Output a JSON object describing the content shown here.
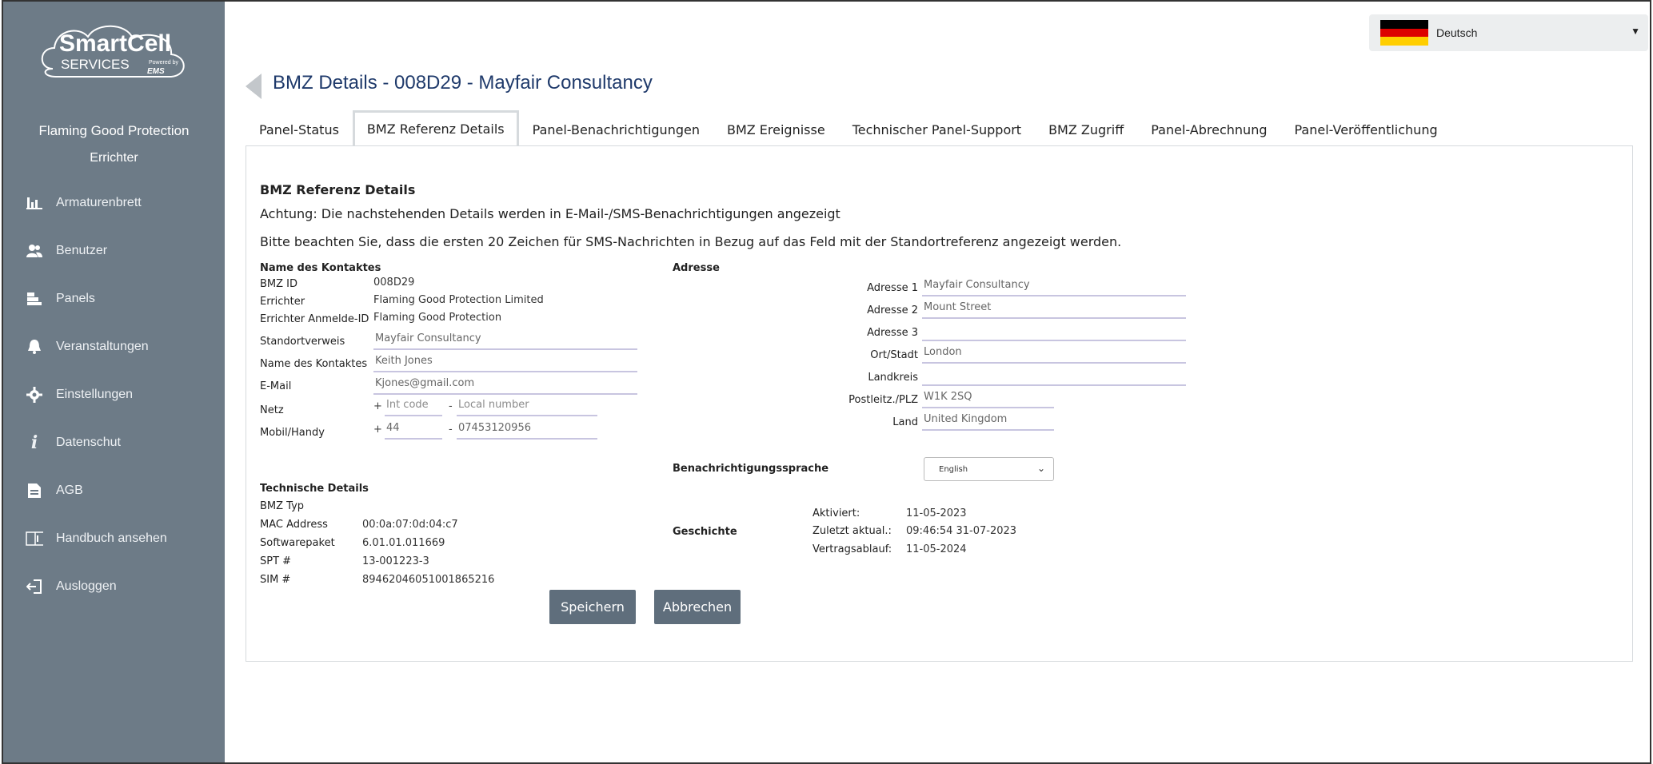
{
  "app": {
    "logo": {
      "line1": "SmartCell",
      "line2": "SERVICES",
      "powered": "Powered by",
      "brand": "EMS"
    },
    "company": "Flaming Good Protection",
    "role": "Errichter"
  },
  "sidebar": {
    "items": [
      {
        "label": "Armaturenbrett",
        "icon": "dashboard-icon"
      },
      {
        "label": "Benutzer",
        "icon": "users-icon"
      },
      {
        "label": "Panels",
        "icon": "panels-icon"
      },
      {
        "label": "Veranstaltungen",
        "icon": "bell-icon"
      },
      {
        "label": "Einstellungen",
        "icon": "gear-icon"
      },
      {
        "label": "Datenschut",
        "icon": "info-icon"
      },
      {
        "label": "AGB",
        "icon": "document-icon"
      },
      {
        "label": "Handbuch ansehen",
        "icon": "book-icon"
      },
      {
        "label": "Ausloggen",
        "icon": "logout-icon"
      }
    ]
  },
  "header": {
    "language": "Deutsch",
    "title": "BMZ Details - 008D29 - Mayfair Consultancy"
  },
  "tabs": [
    {
      "label": "Panel-Status"
    },
    {
      "label": "BMZ Referenz Details",
      "active": true
    },
    {
      "label": "Panel-Benachrichtigungen"
    },
    {
      "label": "BMZ Ereignisse"
    },
    {
      "label": "Technischer Panel-Support"
    },
    {
      "label": "BMZ Zugriff"
    },
    {
      "label": "Panel-Abrechnung"
    },
    {
      "label": "Panel-Veröffentlichung"
    }
  ],
  "main": {
    "section_title": "BMZ Referenz Details",
    "notice1": "Achtung: Die nachstehenden Details werden in E-Mail-/SMS-Benachrichtigungen angezeigt",
    "notice2": "Bitte beachten Sie, dass die ersten 20 Zeichen für SMS-Nachrichten in Bezug auf das Feld mit der Standortreferenz angezeigt werden.",
    "contact": {
      "heading": "Name des Kontaktes",
      "bmz_id_label": "BMZ ID",
      "bmz_id": "008D29",
      "errichter_label": "Errichter",
      "errichter": "Flaming Good Protection Limited",
      "login_label": "Errichter Anmelde-ID",
      "login": "Flaming Good Protection",
      "site_label": "Standortverweis",
      "site": "Mayfair Consultancy",
      "contact_name_label": "Name des Kontaktes",
      "contact_name": "Keith Jones",
      "email_label": "E-Mail",
      "email": "Kjones@gmail.com",
      "net_label": "Netz",
      "net_code_placeholder": "Int code",
      "net_number_placeholder": "Local number",
      "mobile_label": "Mobil/Handy",
      "mobile_code": "44",
      "mobile_number": "07453120956",
      "plus": "+",
      "dash": "-"
    },
    "address": {
      "heading": "Adresse",
      "a1_label": "Adresse 1",
      "a1": "Mayfair Consultancy",
      "a2_label": "Adresse 2",
      "a2": "Mount Street",
      "a3_label": "Adresse 3",
      "a3": "",
      "city_label": "Ort/Stadt",
      "city": "London",
      "county_label": "Landkreis",
      "county": "",
      "postcode_label": "Postleitz./PLZ",
      "postcode": "W1K 2SQ",
      "country_label": "Land",
      "country": "United Kingdom"
    },
    "notification_language": {
      "label": "Benachrichtigungssprache",
      "value": "English"
    },
    "technical": {
      "heading": "Technische Details",
      "type_label": "BMZ Typ",
      "type": "",
      "mac_label": "MAC Address",
      "mac": "00:0a:07:0d:04:c7",
      "software_label": "Softwarepaket",
      "software": "6.01.01.011669",
      "spt_label": "SPT #",
      "spt": "13-001223-3",
      "sim_label": "SIM #",
      "sim": "89462046051001865216"
    },
    "history": {
      "heading": "Geschichte",
      "activated_label": "Aktiviert:",
      "activated": "11-05-2023",
      "updated_label": "Zuletzt aktual.:",
      "updated": "09:46:54 31-07-2023",
      "expiry_label": "Vertragsablauf:",
      "expiry": "11-05-2024"
    },
    "save_label": "Speichern",
    "cancel_label": "Abbrechen"
  },
  "colors": {
    "sidebar": "#6d7b87",
    "title": "#1f3a6b",
    "button": "#5f6e7c",
    "field_underline": "#c8c5e0"
  }
}
